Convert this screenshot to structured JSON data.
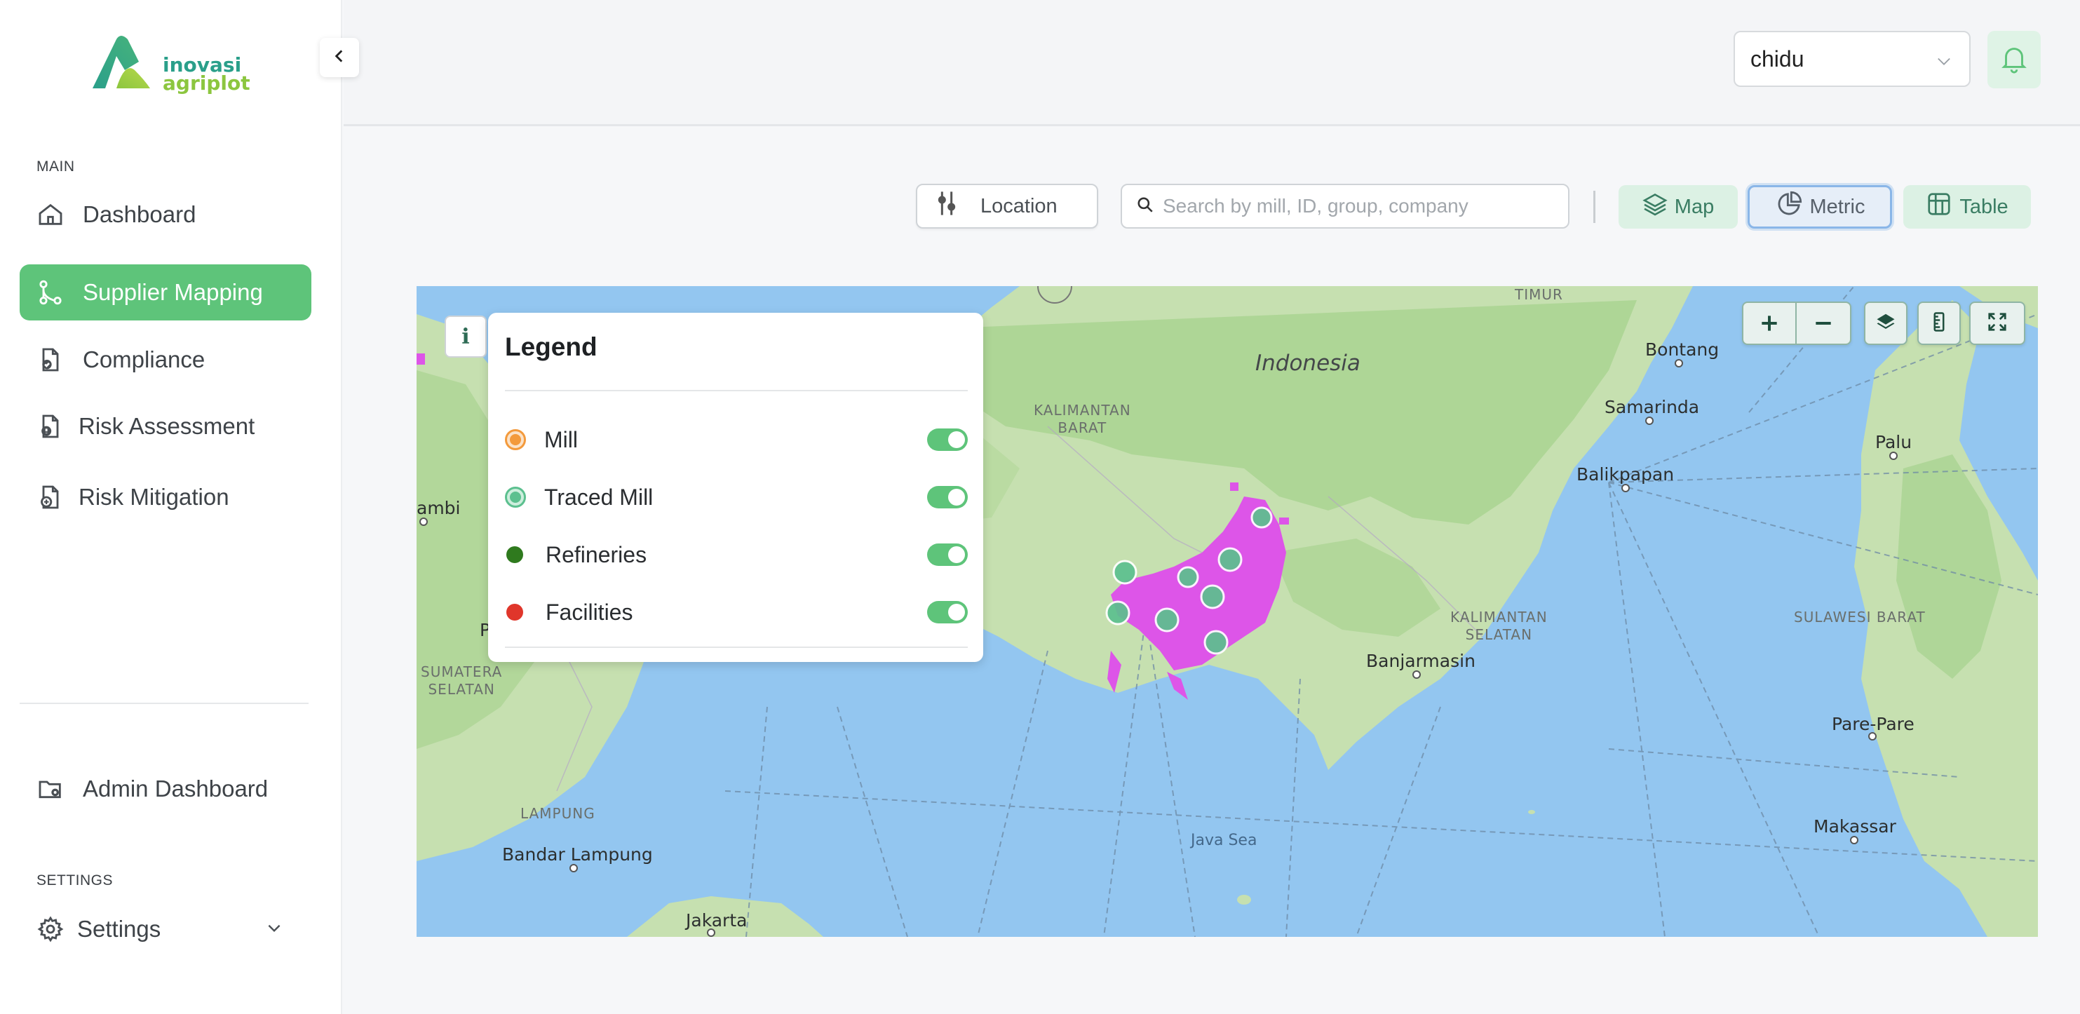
{
  "brand": {
    "line1": "inovasi",
    "line2": "agriplot"
  },
  "sidebar": {
    "main_label": "MAIN",
    "items": [
      {
        "label": "Dashboard",
        "icon": "home-icon"
      },
      {
        "label": "Supplier Mapping",
        "icon": "supplier-mapping-icon",
        "active": true
      },
      {
        "label": "Compliance",
        "icon": "compliance-icon"
      },
      {
        "label": "Risk Assessment",
        "icon": "risk-assessment-icon"
      },
      {
        "label": "Risk Mitigation",
        "icon": "risk-mitigation-icon"
      }
    ],
    "admin": {
      "label": "Admin Dashboard",
      "icon": "admin-folder-icon"
    },
    "settings_label": "SETTINGS",
    "settings": {
      "label": "Settings",
      "icon": "gear-icon"
    }
  },
  "header": {
    "user": "chidu"
  },
  "toolbar": {
    "location_label": "Location",
    "search_placeholder": "Search by mill, ID, group, company",
    "views": {
      "map": "Map",
      "metric": "Metric",
      "table": "Table"
    },
    "active_view": "metric"
  },
  "legend": {
    "title": "Legend",
    "items": [
      {
        "label": "Mill",
        "color": "#f39a3c",
        "enabled": true
      },
      {
        "label": "Traced Mill",
        "color": "#5cc08f",
        "enabled": true
      },
      {
        "label": "Refineries",
        "color": "#2f7a1e",
        "enabled": true
      },
      {
        "label": "Facilities",
        "color": "#e0362b",
        "enabled": true
      }
    ]
  },
  "map": {
    "country": "Indonesia",
    "regions": {
      "kalbar": "KALIMANTAN\nBARAT",
      "kalsel": "KALIMANTAN\nSELATAN",
      "sulbar": "SULAWESI BARAT",
      "sumsel": "SUMATERA\nSELATAN",
      "lampung": "LAMPUNG",
      "timur": "TIMUR"
    },
    "sea": "Java Sea",
    "cities": [
      "Bontang",
      "Samarinda",
      "Balikpapan",
      "Palu",
      "Banjarmasin",
      "Pare-Pare",
      "Makassar",
      "Bandar Lampung",
      "Jakarta",
      "ambi",
      "P"
    ],
    "info_button": "i",
    "colors": {
      "land": "#c6e0b0",
      "forest": "#a9d392",
      "water": "#93c6f0",
      "plot": "#dd55e8"
    }
  }
}
